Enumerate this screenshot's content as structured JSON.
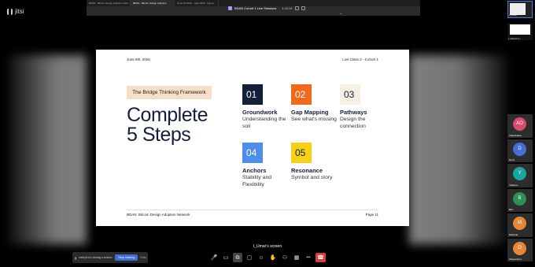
{
  "app": {
    "logo_text": "jitsi"
  },
  "browser": {
    "tabs": [
      "BDAN - Bitcoin Design Adoption Netw",
      "BDAN - Bitcoin Design Adoption",
      "Umar Portfolio - Sept 2025 - Figma"
    ],
    "active_tab": 1
  },
  "share_bar": {
    "title": "BDAN Cohort 1 Live Sessions",
    "timer": "1:10:31"
  },
  "slide": {
    "date": "June 9th, 2026",
    "class": "Live Class 2 - Cohort 1",
    "subtitle": "The Bridge Thinking Framework",
    "headline_line1": "Complete",
    "headline_line2": "5 Steps",
    "steps": [
      {
        "num": "01",
        "title": "Groundwork",
        "desc": "Understanding the soil",
        "bg": "#14203a",
        "fg": "#ffffff"
      },
      {
        "num": "02",
        "title": "Gap Mapping",
        "desc": "See what's missing",
        "bg": "#f06a1d",
        "fg": "#ffffff"
      },
      {
        "num": "03",
        "title": "Pathways",
        "desc": "Design the connection",
        "bg": "#f5efe4",
        "fg": "#14203a"
      },
      {
        "num": "04",
        "title": "Anchors",
        "desc": "Stability and Flexibility",
        "bg": "#4d8fe8",
        "fg": "#ffffff"
      },
      {
        "num": "05",
        "title": "Resonance",
        "desc": "Symbol and story",
        "bg": "#f7d117",
        "fg": "#14203a"
      }
    ],
    "footer_left": "BDAN: Bitcoin Design Adoption Network",
    "footer_right": "Page    11"
  },
  "screen_label": "t_Umar's screen",
  "notice": {
    "text": "meet.jit.si is sharing a window.",
    "stop_label": "Stop sharing",
    "hide_label": "Hide"
  },
  "toolbar": {
    "buttons": [
      {
        "name": "microphone-icon",
        "glyph": "🎤"
      },
      {
        "name": "camera-icon",
        "glyph": "▭"
      },
      {
        "name": "screenshare-icon",
        "glyph": "⧉"
      },
      {
        "name": "chat-icon",
        "glyph": "▢"
      },
      {
        "name": "reactions-icon",
        "glyph": "☺"
      },
      {
        "name": "raise-hand-icon",
        "glyph": "✋"
      },
      {
        "name": "participants-icon",
        "glyph": "⚇"
      },
      {
        "name": "tile-view-icon",
        "glyph": "▦"
      },
      {
        "name": "more-icon",
        "glyph": "•••"
      },
      {
        "name": "hangup-icon",
        "glyph": "☎"
      }
    ]
  },
  "self_view": {
    "label": "t_Umar"
  },
  "second_thumb": {
    "label": "t_Umar's s..."
  },
  "participants": [
    {
      "initials": "AO",
      "name": "Adejobalaw...",
      "color": "#d74b6c"
    },
    {
      "initials": "D",
      "name": "Dami",
      "color": "#4470d6"
    },
    {
      "initials": "Y",
      "name": "Yellance",
      "color": "#1aa5a0"
    },
    {
      "initials": "B",
      "name": "Ben",
      "color": "#2f8f55"
    },
    {
      "initials": "M",
      "name": "Meshval",
      "color": "#e3873c"
    },
    {
      "initials": "O",
      "name": "Okwuchinel",
      "color": "#e3873c"
    }
  ]
}
